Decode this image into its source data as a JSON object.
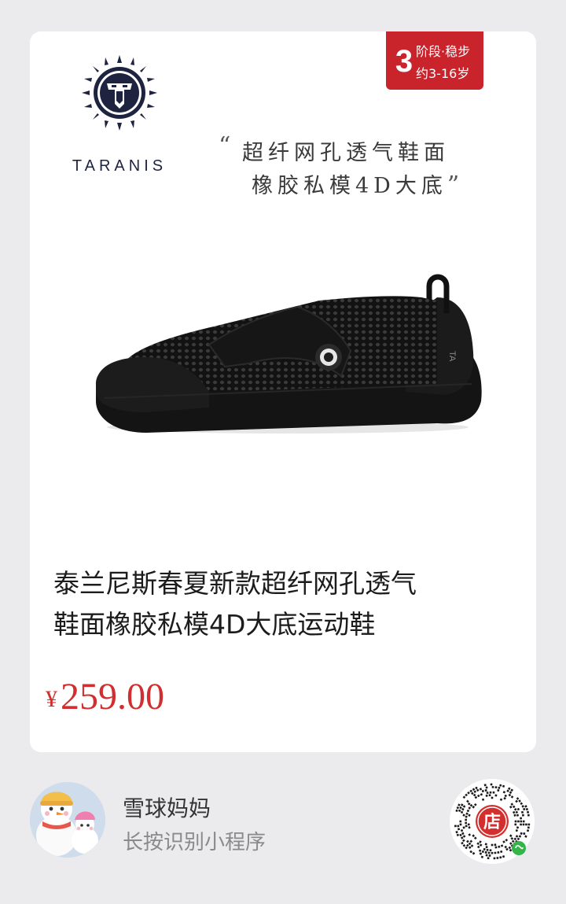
{
  "brand": {
    "name": "TARANIS"
  },
  "stage_badge": {
    "number": "3",
    "line1": "阶段·稳步",
    "line2": "约3-16岁"
  },
  "slogan": {
    "open_quote": "“",
    "line1": "超纤网孔透气鞋面",
    "line2": "橡胶私模4D大底",
    "close_quote": "”"
  },
  "product": {
    "title_line1": "泰兰尼斯春夏新款超纤网孔透气",
    "title_line2": "鞋面橡胶私模4D大底运动鞋",
    "currency": "¥",
    "price": "259.00"
  },
  "footer": {
    "shop_name": "雪球妈妈",
    "hint": "长按识别小程序"
  },
  "qr": {
    "center_label": "店"
  },
  "colors": {
    "accent": "#c9242c",
    "price": "#d12f2f",
    "brand": "#1e2440",
    "background": "#ebebed"
  },
  "icons": {
    "brand_mark": "lion-sun-logo-icon",
    "product_image": "black-mesh-sneaker",
    "avatar": "snowman-avatar",
    "qr": "mini-program-qr-code"
  }
}
